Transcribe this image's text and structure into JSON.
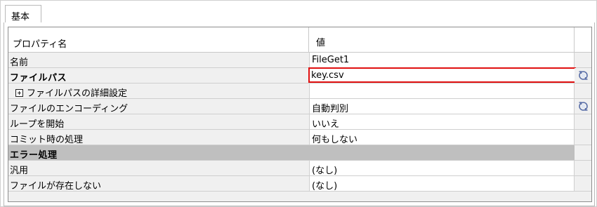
{
  "tabs": [
    {
      "label": "基本"
    }
  ],
  "table": {
    "header": {
      "name": "プロパティ名",
      "value": "値"
    },
    "rows": [
      {
        "name": "名前",
        "value": "FileGet1"
      },
      {
        "name": "ファイルパス",
        "value": "key.csv"
      },
      {
        "name": "ファイルパスの詳細設定",
        "value": ""
      },
      {
        "name": "ファイルのエンコーディング",
        "value": "自動判別"
      },
      {
        "name": "ループを開始",
        "value": "いいえ"
      },
      {
        "name": "コミット時の処理",
        "value": "何もしない"
      },
      {
        "name": "エラー処理"
      },
      {
        "name": "汎用",
        "value": "(なし)"
      },
      {
        "name": "ファイルが存在しない",
        "value": "(なし)"
      }
    ]
  },
  "colors": {
    "highlight": "#e01010",
    "section_background": "#bfbfbf",
    "row_background": "#f0f0f0"
  },
  "icons": [
    "expand-plus-icon",
    "refresh-icon"
  ]
}
